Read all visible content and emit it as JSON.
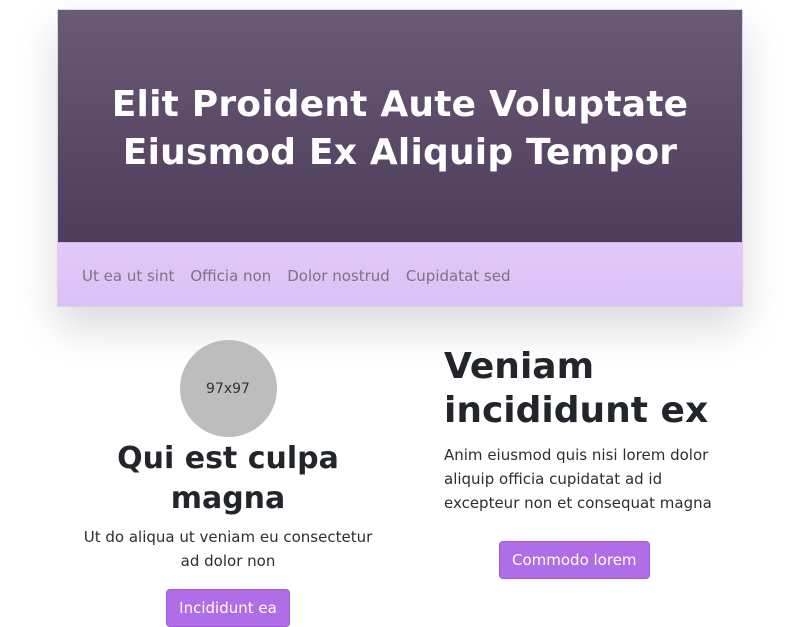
{
  "hero": {
    "title_line1": "Elit Proident Aute Voluptate",
    "title_line2": "Eiusmod Ex Aliquip Tempor"
  },
  "nav": {
    "items": [
      {
        "label": "Ut ea ut sint"
      },
      {
        "label": "Officia non"
      },
      {
        "label": "Dolor nostrud"
      },
      {
        "label": "Cupidatat sed"
      }
    ]
  },
  "left": {
    "avatar_label": "97x97",
    "heading": "Qui est culpa magna",
    "text": "Ut do aliqua ut veniam eu consectetur ad dolor non",
    "button": "Incididunt ea"
  },
  "right": {
    "heading": "Veniam incididunt ex",
    "text": "Anim eiusmod quis nisi lorem dolor aliquip officia cupidatat ad id excepteur non et consequat magna",
    "button": "Commodo lorem"
  },
  "colors": {
    "hero_bg": "#5a4a6a",
    "nav_bg": "#e0c6f8",
    "button_bg": "#b06de8"
  }
}
